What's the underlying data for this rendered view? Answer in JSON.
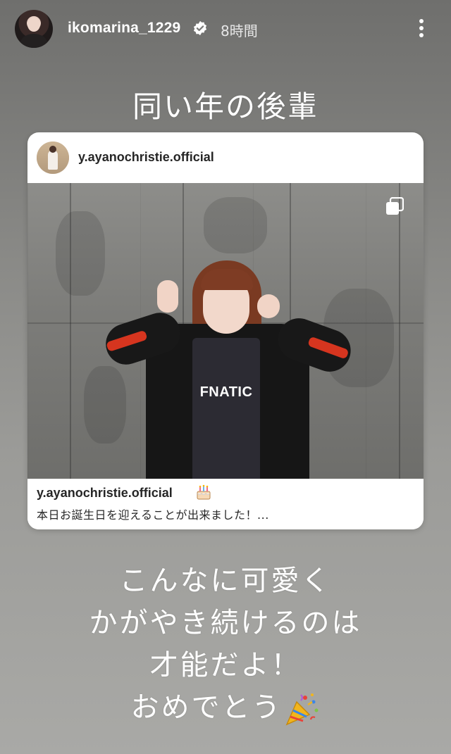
{
  "header": {
    "username": "ikomarina_1229",
    "time_ago": "8時間"
  },
  "caption_top": "同い年の後輩",
  "shared_post": {
    "username": "y.ayanochristie.official",
    "photo_jersey_text": "FNATIC",
    "caption_username": "y.ayanochristie.official",
    "caption_text": "本日お誕生日を迎えることが出来ました！..."
  },
  "caption_bottom": {
    "line1": "こんなに可愛く",
    "line2": "かがやき続けるのは",
    "line3": "才能だよ！",
    "line4": "おめでとう"
  },
  "icons": {
    "verified": "verified-badge-icon",
    "more": "more-vertical-icon",
    "carousel": "multiple-photos-icon",
    "cake": "birthday-cake-icon",
    "party": "party-popper-icon"
  },
  "colors": {
    "verified_blue": "#3897f0",
    "accent_red": "#d6351f"
  }
}
